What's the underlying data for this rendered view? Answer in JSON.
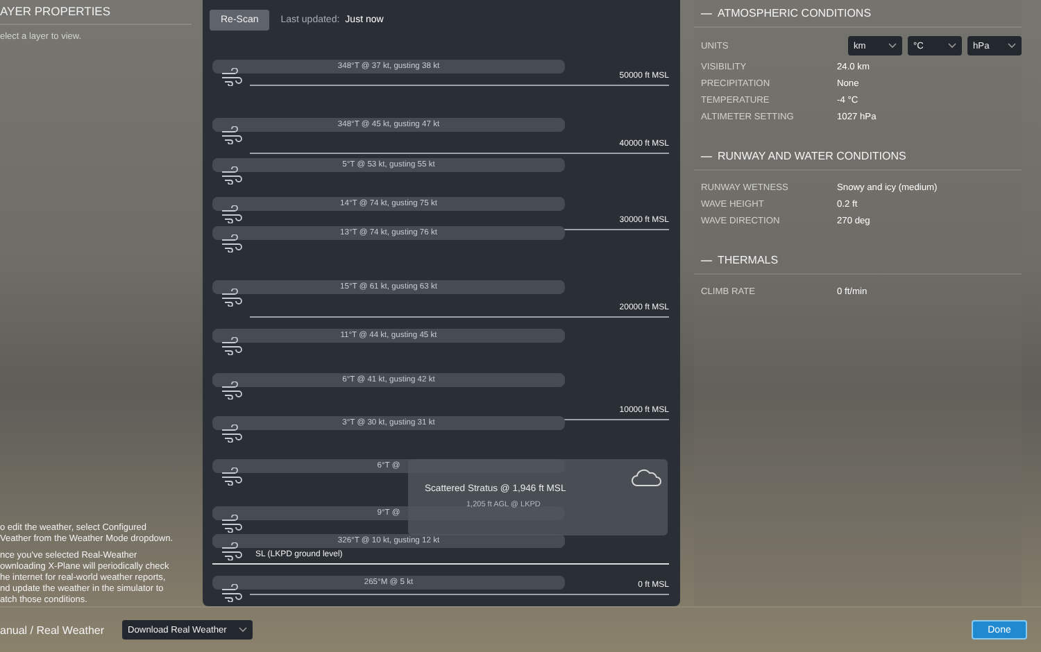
{
  "left_panel": {
    "title": "AYER PROPERTIES",
    "hint": "elect a layer to view.",
    "notes": [
      [
        "o edit the weather, select Configured",
        "Veather from the Weather Mode dropdown."
      ],
      [
        "nce you've selected Real-Weather",
        "ownloading X-Plane will periodically check",
        "he internet for real-world weather reports,",
        "nd update the weather in the simulator to",
        "atch those conditions."
      ]
    ]
  },
  "scan": {
    "button": "Re-Scan",
    "label": "Last updated:",
    "value": "Just now"
  },
  "wind_layers": [
    {
      "text": "348°T @ 37 kt, gusting 38 kt"
    },
    {
      "text": "348°T @ 45 kt, gusting 47 kt"
    },
    {
      "text": "5°T @ 53 kt, gusting 55 kt"
    },
    {
      "text": "14°T @ 74 kt, gusting 75 kt"
    },
    {
      "text": "13°T @ 74 kt, gusting 76 kt"
    },
    {
      "text": "15°T @ 61 kt, gusting 63 kt"
    },
    {
      "text": "11°T @ 44 kt, gusting 45 kt"
    },
    {
      "text": "6°T @ 41 kt, gusting 42 kt"
    },
    {
      "text": "3°T @ 30 kt, gusting 31 kt"
    },
    {
      "text": "6°T @"
    },
    {
      "text": "9°T @"
    },
    {
      "text": "326°T @ 10 kt, gusting 12 kt"
    },
    {
      "text": "265°M @ 5 kt"
    }
  ],
  "altitude_markers": [
    {
      "kind": "altitude",
      "label": "50000 ft MSL"
    },
    {
      "kind": "altitude",
      "label": "40000 ft MSL"
    },
    {
      "kind": "altitude",
      "label": "30000 ft MSL"
    },
    {
      "kind": "altitude",
      "label": "20000 ft MSL"
    },
    {
      "kind": "altitude",
      "label": "10000 ft MSL"
    },
    {
      "kind": "ground",
      "label": "SL (LKPD ground level)"
    },
    {
      "kind": "altitude",
      "label": "0 ft MSL"
    }
  ],
  "cloud_popup": {
    "title": "Scattered Stratus @ 1,946 ft MSL",
    "subtitle": "1,205 ft AGL @ LKPD"
  },
  "sections": [
    {
      "title": "ATMOSPHERIC CONDITIONS",
      "units": [
        "km",
        "°C",
        "hPa"
      ],
      "units_label": "UNITS",
      "rows": [
        {
          "label": "VISIBILITY",
          "value": "24.0 km"
        },
        {
          "label": "PRECIPITATION",
          "value": "None"
        },
        {
          "label": "TEMPERATURE",
          "value": "-4 °C"
        },
        {
          "label": "ALTIMETER SETTING",
          "value": "1027 hPa"
        }
      ]
    },
    {
      "title": "RUNWAY AND WATER CONDITIONS",
      "rows": [
        {
          "label": "RUNWAY WETNESS",
          "value": "Snowy and icy (medium)"
        },
        {
          "label": "WAVE HEIGHT",
          "value": "0.2 ft"
        },
        {
          "label": "WAVE DIRECTION",
          "value": "270 deg"
        }
      ]
    },
    {
      "title": "THERMALS",
      "rows": [
        {
          "label": "CLIMB RATE",
          "value": "0 ft/min"
        }
      ]
    }
  ],
  "bottom_bar": {
    "mode_label": "anual / Real Weather",
    "mode_value": "Download Real Weather",
    "done": "Done"
  }
}
